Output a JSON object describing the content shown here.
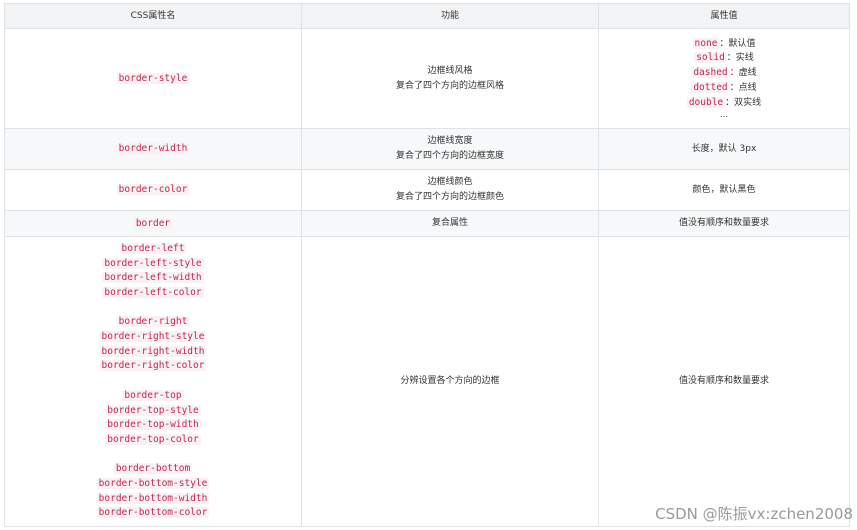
{
  "headers": [
    "CSS属性名",
    "功能",
    "属性值"
  ],
  "rows": [
    {
      "name": "border-style",
      "func": [
        "边框线风格",
        "复合了四个方向的边框风格"
      ],
      "values": [
        {
          "code": "none",
          "text": "：默认值"
        },
        {
          "code": "solid",
          "text": "：实线"
        },
        {
          "code": "dashed",
          "text": "：虚线"
        },
        {
          "code": "dotted",
          "text": "：点线"
        },
        {
          "code": "double",
          "text": "：双实线"
        }
      ],
      "values_more": "..."
    },
    {
      "name": "border-width",
      "func": [
        "边框线宽度",
        "复合了四个方向的边框宽度"
      ],
      "value": "长度，默认 3px"
    },
    {
      "name": "border-color",
      "func": [
        "边框线颜色",
        "复合了四个方向的边框颜色"
      ],
      "value": "颜色，默认黑色"
    },
    {
      "name": "border",
      "func": [
        "复合属性"
      ],
      "value": "值没有顺序和数量要求"
    },
    {
      "groups": [
        [
          "border-left",
          "border-left-style",
          "border-left-width",
          "border-left-color"
        ],
        [
          "border-right",
          "border-right-style",
          "border-right-width",
          "border-right-color"
        ],
        [
          "border-top",
          "border-top-style",
          "border-top-width",
          "border-top-color"
        ],
        [
          "border-bottom",
          "border-bottom-style",
          "border-bottom-width",
          "border-bottom-color"
        ]
      ],
      "func": "分辨设置各个方向的边框",
      "value": "值没有顺序和数量要求"
    }
  ],
  "watermark": "CSDN @陈振vx:zchen2008"
}
